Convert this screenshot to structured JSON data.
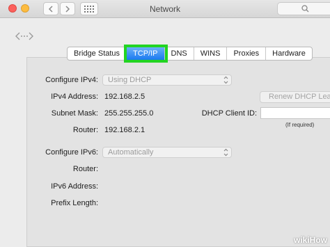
{
  "window": {
    "title": "Network"
  },
  "tabs": [
    {
      "label": "Bridge Status",
      "active": false
    },
    {
      "label": "TCP/IP",
      "active": true
    },
    {
      "label": "DNS",
      "active": false
    },
    {
      "label": "WINS",
      "active": false
    },
    {
      "label": "Proxies",
      "active": false
    },
    {
      "label": "Hardware",
      "active": false
    }
  ],
  "ipv4": {
    "configure_label": "Configure IPv4:",
    "configure_value": "Using DHCP",
    "address_label": "IPv4 Address:",
    "address_value": "192.168.2.5",
    "subnet_label": "Subnet Mask:",
    "subnet_value": "255.255.255.0",
    "router_label": "Router:",
    "router_value": "192.168.2.1",
    "renew_button": "Renew DHCP Lease",
    "client_id_label": "DHCP Client ID:",
    "client_id_value": "",
    "client_id_hint": "(If required)"
  },
  "ipv6": {
    "configure_label": "Configure IPv6:",
    "configure_value": "Automatically",
    "router_label": "Router:",
    "address_label": "IPv6 Address:",
    "prefix_label": "Prefix Length:"
  },
  "watermark": "wikiHow",
  "colors": {
    "highlight": "#22d422",
    "active_tab": "#1b79f0"
  }
}
